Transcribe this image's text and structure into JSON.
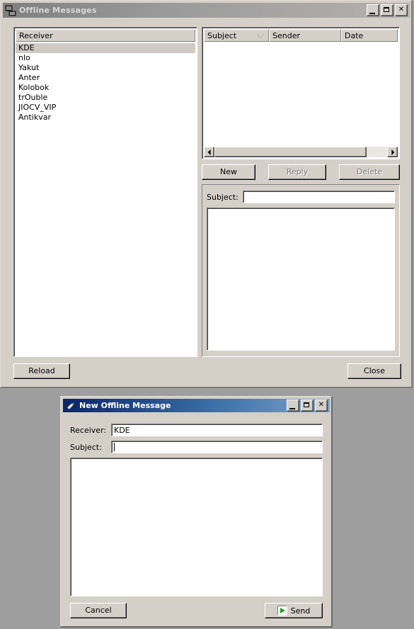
{
  "desktop": {
    "background": "#9e9e9e"
  },
  "main_window": {
    "title": "Offline Messages",
    "icon": "computers-network-icon",
    "active": false,
    "titlebar_buttons": [
      {
        "name": "minimize",
        "label": "_"
      },
      {
        "name": "maximize",
        "label": "❑"
      },
      {
        "name": "close",
        "label": "✕"
      }
    ],
    "receiver_list": {
      "header": "Receiver",
      "items": [
        {
          "label": "KDE",
          "selected": true
        },
        {
          "label": "nlo",
          "selected": false
        },
        {
          "label": "Yakut",
          "selected": false
        },
        {
          "label": "Anter",
          "selected": false
        },
        {
          "label": "Kolobok",
          "selected": false
        },
        {
          "label": "trOuble",
          "selected": false
        },
        {
          "label": "JIOCV_VIP",
          "selected": false
        },
        {
          "label": "Antikvar",
          "selected": false
        }
      ],
      "selection_color": "#cfcbc4"
    },
    "message_table": {
      "columns": [
        {
          "label": "Subject",
          "sorted": true,
          "sort_direction": "descending"
        },
        {
          "label": "Sender",
          "sorted": false
        },
        {
          "label": "Date",
          "sorted": false
        }
      ],
      "rows": []
    },
    "actions": [
      {
        "name": "new",
        "label": "New",
        "enabled": true
      },
      {
        "name": "reply",
        "label": "Reply",
        "enabled": false
      },
      {
        "name": "delete",
        "label": "Delete",
        "enabled": false
      }
    ],
    "compose_preview": {
      "subject_label": "Subject:",
      "subject_value": "",
      "body_value": ""
    },
    "footer": {
      "reload_label": "Reload",
      "close_label": "Close"
    }
  },
  "dialog_window": {
    "title": "New Offline Message",
    "icon": "pencil-icon",
    "active": true,
    "titlebar_color_start": "#0a246a",
    "titlebar_color_end": "#7ba2cc",
    "titlebar_buttons": [
      {
        "name": "minimize",
        "label": "_"
      },
      {
        "name": "maximize",
        "label": "❑"
      },
      {
        "name": "close",
        "label": "✕"
      }
    ],
    "fields": {
      "receiver_label": "Receiver:",
      "receiver_value": "KDE",
      "subject_label": "Subject:",
      "subject_value": "",
      "subject_focused": true,
      "body_value": ""
    },
    "footer": {
      "cancel_label": "Cancel",
      "send_label": "Send",
      "send_icon": "green-play-triangle-icon"
    }
  }
}
